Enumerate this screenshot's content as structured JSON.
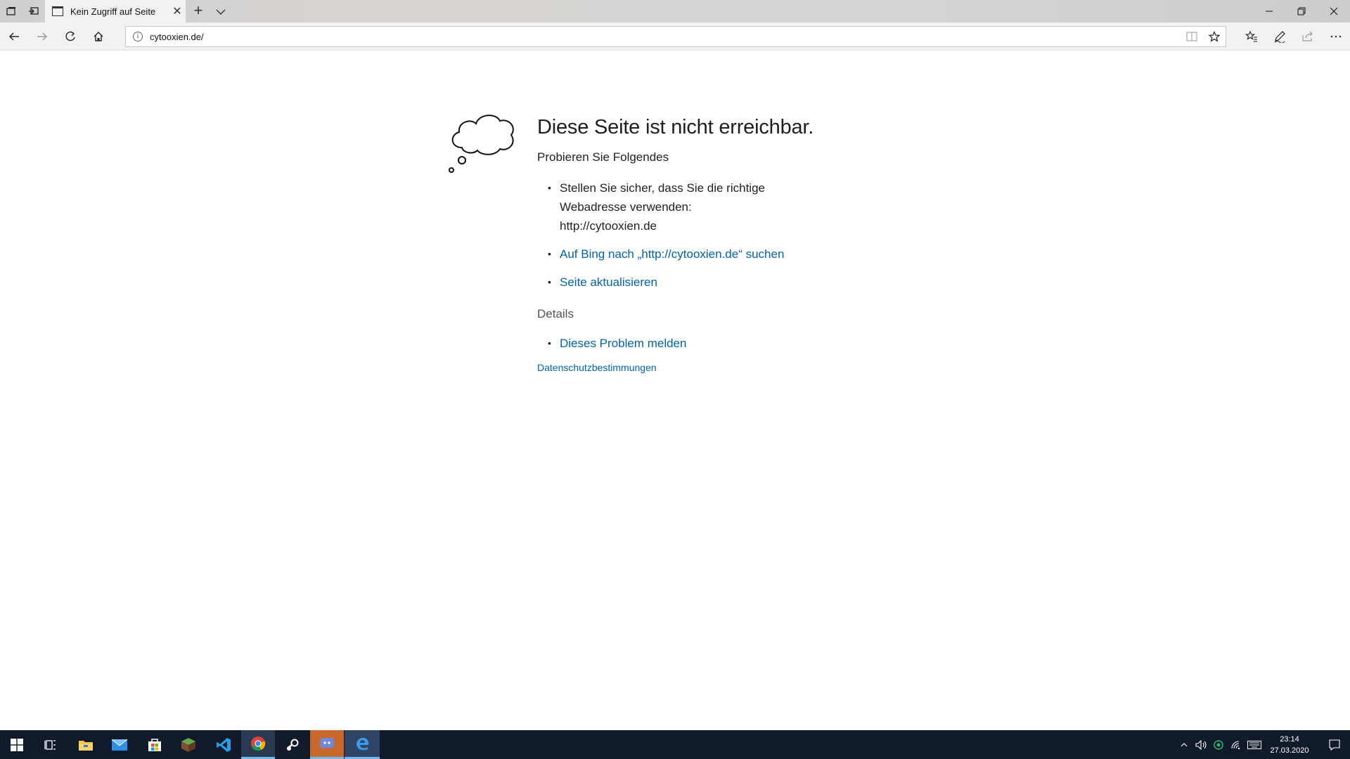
{
  "browser": {
    "tab_title": "Kein Zugriff auf Seite",
    "url": "cytooxien.de/"
  },
  "page": {
    "heading": "Diese Seite ist nicht erreichbar.",
    "subheading": "Probieren Sie Folgendes",
    "tips": [
      {
        "text": "Stellen Sie sicher, dass Sie die richtige Webadresse verwenden: http://cytooxien.de",
        "link": false
      },
      {
        "text": "Auf Bing nach „http://cytooxien.de“ suchen",
        "link": true
      },
      {
        "text": "Seite aktualisieren",
        "link": true
      }
    ],
    "tip1_line1": "Stellen Sie sicher, dass Sie die richtige",
    "tip1_line2": "Webadresse verwenden:",
    "tip1_line3": "http://cytooxien.de",
    "details_label": "Details",
    "report_link": "Dieses Problem melden",
    "privacy_link": "Datenschutzbestimmungen"
  },
  "taskbar": {
    "time": "23:14",
    "date": "27.03.2020",
    "apps": [
      "start-icon",
      "task-view-icon",
      "file-explorer-icon",
      "mail-icon",
      "store-icon",
      "minecraft-icon",
      "vscode-icon",
      "chrome-icon",
      "steam-icon",
      "discord-icon",
      "edge-icon"
    ]
  },
  "colors": {
    "link": "#0063b1",
    "taskbar": "#101a2a"
  }
}
